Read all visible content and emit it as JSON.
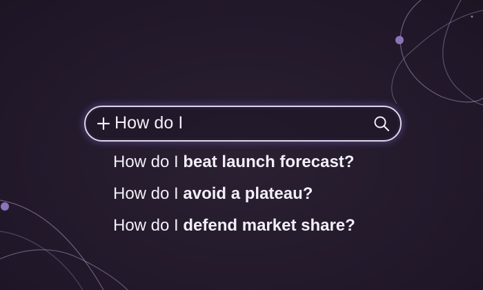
{
  "search": {
    "query": "How do I",
    "icons": {
      "left": "plus-icon",
      "right": "search-icon"
    }
  },
  "suggestions": [
    {
      "prefix": "How do I",
      "completion": "beat launch forecast?"
    },
    {
      "prefix": "How do I",
      "completion": "avoid a plateau?"
    },
    {
      "prefix": "How do I",
      "completion": "defend market share?"
    }
  ],
  "colors": {
    "background": "#231a2b",
    "text": "#f3eff7",
    "glow": "#7d62c4",
    "orbit": "#a99bc4",
    "node": "#8c74b8"
  }
}
